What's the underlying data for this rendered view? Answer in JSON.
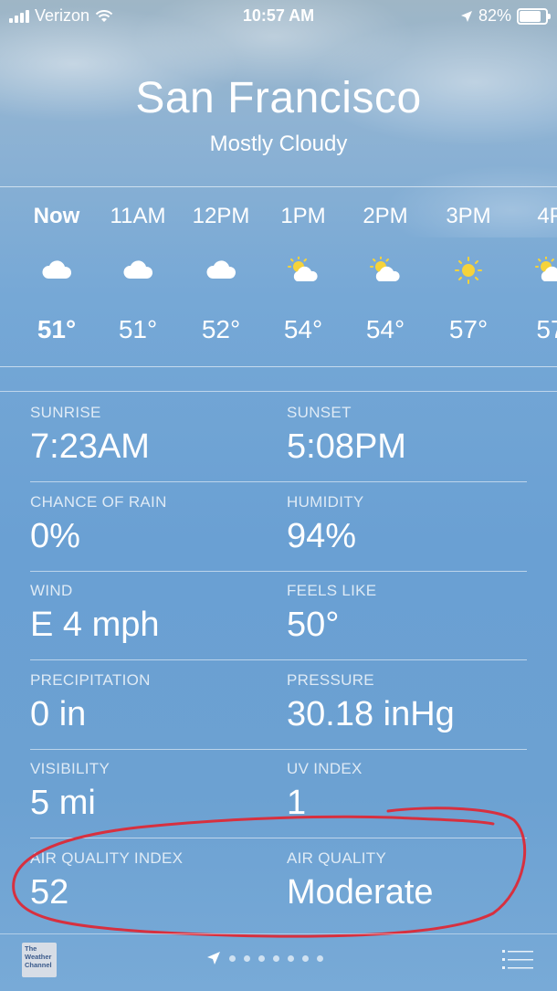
{
  "status_bar": {
    "carrier": "Verizon",
    "time": "10:57 AM",
    "battery": "82%",
    "battery_level": 0.82
  },
  "header": {
    "city": "San Francisco",
    "condition": "Mostly Cloudy"
  },
  "hourly": [
    {
      "label": "Now",
      "icon": "cloud-icon",
      "temp": "51°"
    },
    {
      "label": "11AM",
      "icon": "cloud-icon",
      "temp": "51°"
    },
    {
      "label": "12PM",
      "icon": "cloud-icon",
      "temp": "52°"
    },
    {
      "label": "1PM",
      "icon": "partly-sunny-icon",
      "temp": "54°"
    },
    {
      "label": "2PM",
      "icon": "partly-sunny-icon",
      "temp": "54°"
    },
    {
      "label": "3PM",
      "icon": "sun-icon",
      "temp": "57°"
    },
    {
      "label": "4P",
      "icon": "partly-sunny-icon",
      "temp": "57"
    }
  ],
  "details": [
    {
      "left_label": "SUNRISE",
      "left_value": "7:23AM",
      "right_label": "SUNSET",
      "right_value": "5:08PM"
    },
    {
      "left_label": "CHANCE OF RAIN",
      "left_value": "0%",
      "right_label": "HUMIDITY",
      "right_value": "94%"
    },
    {
      "left_label": "WIND",
      "left_value": "E 4 mph",
      "right_label": "FEELS LIKE",
      "right_value": "50°"
    },
    {
      "left_label": "PRECIPITATION",
      "left_value": "0 in",
      "right_label": "PRESSURE",
      "right_value": "30.18 inHg"
    },
    {
      "left_label": "VISIBILITY",
      "left_value": "5 mi",
      "right_label": "UV INDEX",
      "right_value": "1"
    },
    {
      "left_label": "AIR QUALITY INDEX",
      "left_value": "52",
      "right_label": "AIR QUALITY",
      "right_value": "Moderate"
    }
  ],
  "annotation_color": "#d7303f",
  "bottom_bar": {
    "logo_text": "The Weather Channel",
    "page_dots": 7
  }
}
